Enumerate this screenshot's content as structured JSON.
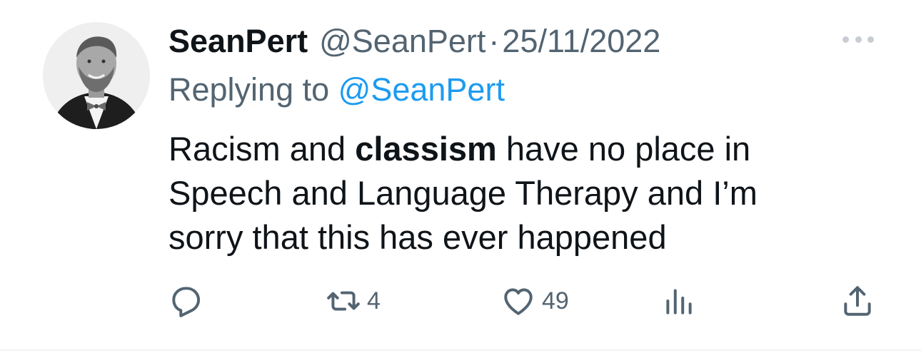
{
  "tweet": {
    "display_name": "SeanPert",
    "handle": "@SeanPert",
    "separator": "·",
    "date": "25/11/2022",
    "replying_prefix": "Replying to ",
    "replying_handle": "@SeanPert",
    "text_part1": "Racism and ",
    "text_bold": "classism",
    "text_part2": " have no place in Speech and Language Therapy and I’m sorry that this has ever happened",
    "avatar_icon": "user-avatar-photo"
  },
  "actions": {
    "reply": {
      "icon": "reply-icon"
    },
    "retweet": {
      "icon": "retweet-icon",
      "count": "4"
    },
    "like": {
      "icon": "heart-icon",
      "count": "49"
    },
    "views": {
      "icon": "views-bar-chart-icon"
    },
    "share": {
      "icon": "share-icon"
    }
  },
  "colors": {
    "text_primary": "#0f1419",
    "text_secondary": "#536471",
    "link": "#1d9bf0",
    "more_dots": "#c7cdd2"
  }
}
